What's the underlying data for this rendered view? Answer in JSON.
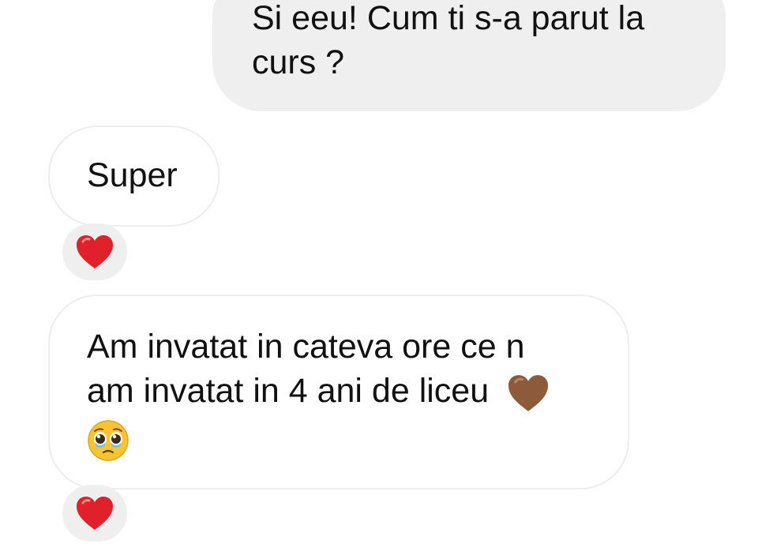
{
  "messages": [
    {
      "direction": "outgoing",
      "lines": [
        "Si eeu! Cum ti s-a parut la",
        "curs ?"
      ]
    },
    {
      "direction": "incoming",
      "lines": [
        "Super"
      ],
      "reaction": "red-heart"
    },
    {
      "direction": "incoming",
      "lines": [
        "Am invatat in cateva ore ce n",
        "am invatat in 4 ani de liceu"
      ],
      "emojis": [
        "brown-heart",
        "pleading-face"
      ],
      "reaction": "red-heart"
    }
  ],
  "colors": {
    "outgoing_bubble": "#efefef",
    "incoming_border": "#ededed",
    "reaction_bg": "#efefef",
    "red_heart": "#e0202a",
    "brown_heart": "#8d5a3c"
  }
}
